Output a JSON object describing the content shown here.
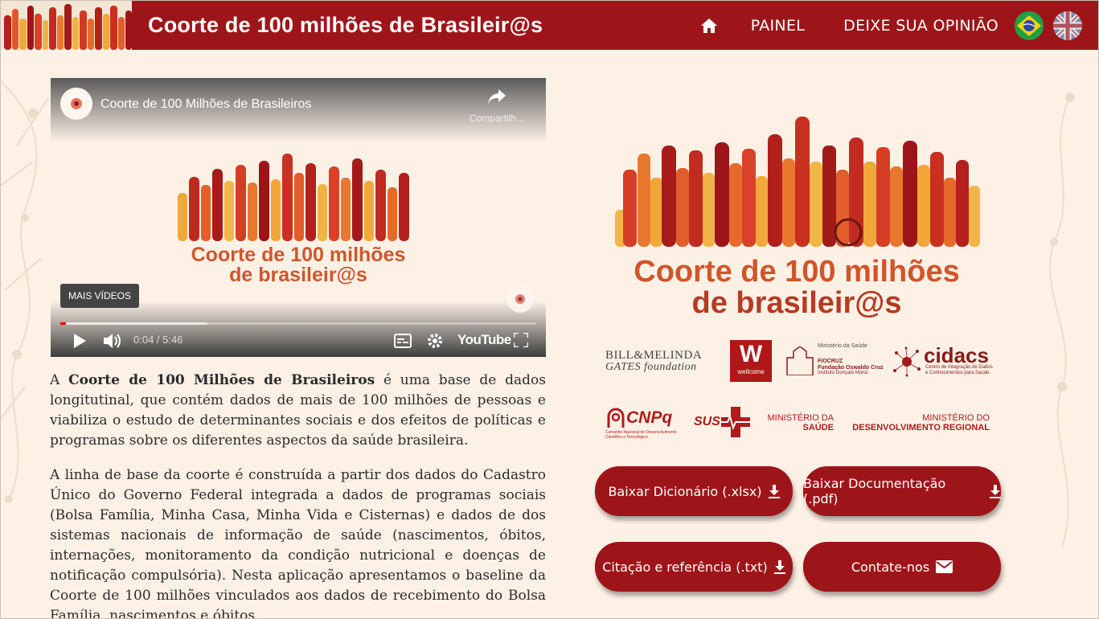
{
  "header": {
    "title": "Coorte de 100 milhões de Brasileir@s",
    "nav": {
      "home_icon": "home-icon",
      "painel": "PAINEL",
      "opiniao": "DEIXE SUA OPINIÃO"
    },
    "flags": [
      "brazil-flag-icon",
      "uk-flag-icon"
    ]
  },
  "video": {
    "title": "Coorte de 100 Milhões de Brasileiros",
    "share_label": "Compartilh...",
    "more_videos": "MAIS VÍDEOS",
    "time": "0:04 / 5:46",
    "youtube_label": "YouTube",
    "logo_line1": "Coorte de 100 milhões",
    "logo_line2": "de brasileir@s",
    "progress_fraction": 0.007
  },
  "intro": {
    "p1_pre": "A ",
    "p1_bold": "Coorte de 100 Milhões de Brasileiros",
    "p1_post": " é uma base de dados longitutinal, que contém dados de mais de 100 milhões de pessoas e viabiliza o estudo de determinantes sociais e dos efeitos de políticas e programas sobre os diferentes aspectos da saúde brasileira.",
    "p2": "A linha de base da coorte é construída a partir dos dados do Cadastro Único do Governo Federal integrada a dados de programas sociais (Bolsa Família, Minha Casa, Minha Vida e Cisternas) e dados de dos sistemas nacionais de informação de saúde (nascimentos, óbitos, internações, monitoramento da condição nutricional e doenças de notificação compulsória). Nesta aplicação apresentamos o baseline da Coorte de 100 milhões vinculados aos dados de recebimento do Bolsa Família, nascimentos e óbitos."
  },
  "logo": {
    "line1": "Coorte de 100 milhões",
    "line2": "de brasileir@s"
  },
  "partners": {
    "gates_1": "BILL&MELINDA",
    "gates_2": "GATES foundation",
    "wellcome": "wellcome",
    "fiocruz_top": "Ministério da Saúde",
    "fiocruz_1": "FIOCRUZ",
    "fiocruz_2": "Fundação Oswaldo Cruz",
    "fiocruz_3": "Instituto Gonçalo Moniz",
    "cidacs": "cidacs",
    "cidacs_sub1": "Centro de Integração de Dados",
    "cidacs_sub2": "e Conhecimentos para Saúde",
    "cnpq": "CNPq",
    "cnpq_sub1": "Conselho Nacional de Desenvolvimento",
    "cnpq_sub2": "Científico e Tecnológico",
    "sus": "SUS",
    "ms_1": "MINISTÉRIO DA",
    "ms_2": "SAÚDE",
    "mdr_1": "MINISTÉRIO DO",
    "mdr_2": "DESENVOLVIMENTO REGIONAL"
  },
  "buttons": {
    "dicionario": "Baixar Dicionário (.xlsx)",
    "documentacao": "Baixar Documentação (.pdf)",
    "citacao": "Citação e referência (.txt)",
    "contato": "Contate-nos"
  },
  "colors": {
    "brand_red": "#9e1519",
    "background": "#fdf1e6",
    "logo_orange": "#d1552a"
  }
}
